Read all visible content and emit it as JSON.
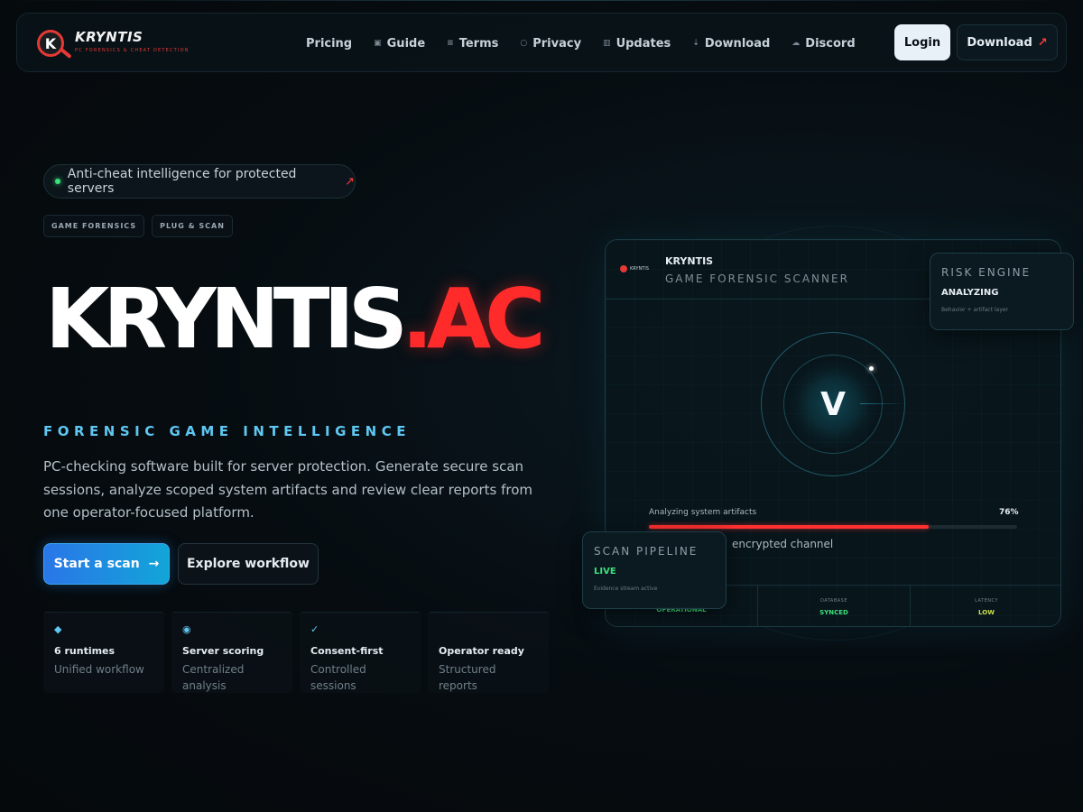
{
  "brand": {
    "name": "KRYNTIS",
    "logo_letter": "K",
    "tagline": "PC FORENSICS & CHEAT DETECTION"
  },
  "nav": {
    "links": [
      {
        "label": "Pricing",
        "icon": ""
      },
      {
        "label": "Guide",
        "icon": "guide-icon"
      },
      {
        "label": "Terms",
        "icon": "terms-icon"
      },
      {
        "label": "Privacy",
        "icon": "privacy-icon"
      },
      {
        "label": "Updates",
        "icon": "updates-icon"
      },
      {
        "label": "Download",
        "icon": "download-icon"
      },
      {
        "label": "Discord",
        "icon": "discord-icon"
      }
    ],
    "login_label": "Login",
    "download_label": "Download",
    "arrow": "↗"
  },
  "hero": {
    "pill_text": "Anti-cheat intelligence for protected servers",
    "tags": [
      "GAME FORENSICS",
      "PLUG & SCAN"
    ],
    "title_main": "KRYNTIS",
    "title_accent": ".AC",
    "subtitle": "FORENSIC GAME INTELLIGENCE",
    "description": "PC-checking software built for server protection. Generate secure scan sessions, analyze scoped system artifacts and review clear reports from one operator-focused platform.",
    "start_label": "Start a scan",
    "start_arrow": "→",
    "explore_label": "Explore workflow"
  },
  "features": [
    {
      "icon": "◆",
      "title": "6 runtimes",
      "sub": "Unified workflow"
    },
    {
      "icon": "◉",
      "title": "Server scoring",
      "sub": "Centralized analysis"
    },
    {
      "icon": "✓",
      "title": "Consent-first",
      "sub": "Controlled sessions"
    },
    {
      "icon": "",
      "title": "Operator ready",
      "sub": "Structured reports"
    }
  ],
  "scanner": {
    "mini_logo": "KRYNTIS",
    "name": "KRYNTIS",
    "subtitle": "GAME FORENSIC SCANNER",
    "core_letter": "V",
    "progress_label": "Analyzing system artifacts",
    "progress_value": "76%",
    "progress_fraction": 0.76,
    "channel_text": "encrypted channel",
    "stats": [
      {
        "label": "",
        "value": "OPERATIONAL"
      },
      {
        "label": "DATABASE",
        "value": "SYNCED"
      },
      {
        "label": "LATENCY",
        "value": "LOW"
      }
    ]
  },
  "risk_card": {
    "title": "RISK ENGINE",
    "status": "ANALYZING",
    "note": "Behavior + artifact layer"
  },
  "pipeline_card": {
    "title": "SCAN PIPELINE",
    "status": "LIVE",
    "note": "Evidence stream active"
  },
  "colors": {
    "accent_red": "#ff2b2b",
    "accent_blue": "#5fc7f2",
    "status_green": "#3ee07a",
    "risk_status": "#e6edf2"
  }
}
